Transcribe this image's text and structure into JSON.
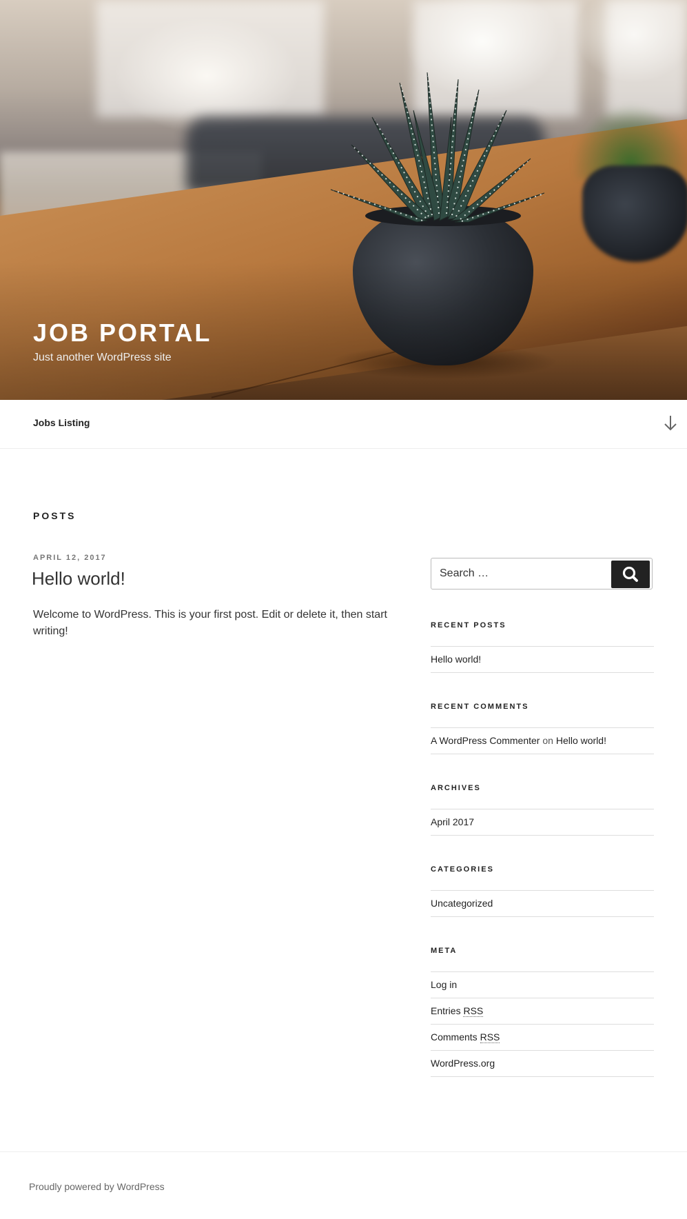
{
  "header": {
    "site_title": "Job Portal",
    "tagline": "Just another WordPress site"
  },
  "nav": {
    "items": [
      {
        "label": "Jobs Listing"
      }
    ],
    "scroll_icon": "arrow-down-icon"
  },
  "main": {
    "page_title": "Posts",
    "post": {
      "date": "April 12, 2017",
      "title": "Hello world!",
      "excerpt": "Welcome to WordPress. This is your first post. Edit or delete it, then start writing!"
    }
  },
  "sidebar": {
    "search": {
      "placeholder": "Search …",
      "icon": "search-icon"
    },
    "recent_posts": {
      "title": "Recent Posts",
      "items": [
        "Hello world!"
      ]
    },
    "recent_comments": {
      "title": "Recent Comments",
      "items": [
        {
          "author": "A WordPress Commenter",
          "connector": "on",
          "post": "Hello world!"
        }
      ]
    },
    "archives": {
      "title": "Archives",
      "items": [
        "April 2017"
      ]
    },
    "categories": {
      "title": "Categories",
      "items": [
        "Uncategorized"
      ]
    },
    "meta": {
      "title": "Meta",
      "items": [
        {
          "text": "Log in"
        },
        {
          "text": "Entries",
          "abbr": "RSS"
        },
        {
          "text": "Comments",
          "abbr": "RSS"
        },
        {
          "text": "WordPress.org"
        }
      ]
    }
  },
  "footer": {
    "text": "Proudly powered by WordPress"
  },
  "colors": {
    "dark_button": "#222222",
    "border": "#dddddd",
    "muted_text": "#767676"
  }
}
